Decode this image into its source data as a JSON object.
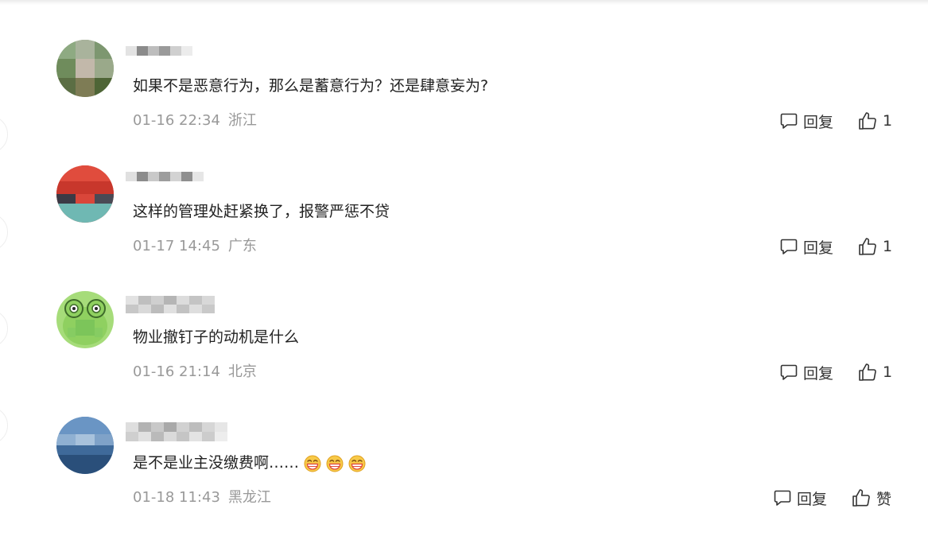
{
  "comments": [
    {
      "text": "如果不是恶意行为，那么是蓄意行为？还是肆意妄为?",
      "time": "01-16 22:34",
      "location": "浙江",
      "reply_label": "回复",
      "like_label": "1"
    },
    {
      "text": "这样的管理处赶紧换了，报警严惩不贷",
      "time": "01-17 14:45",
      "location": "广东",
      "reply_label": "回复",
      "like_label": "1"
    },
    {
      "text": "物业撤钉子的动机是什么",
      "time": "01-16 21:14",
      "location": "北京",
      "reply_label": "回复",
      "like_label": "1"
    },
    {
      "text": "是不是业主没缴费啊……",
      "time": "01-18 11:43",
      "location": "黑龙江",
      "reply_label": "回复",
      "like_label": "赞",
      "emoji_count": 3
    }
  ],
  "icons": {
    "reply": "speech-bubble-icon",
    "like": "thumbs-up-icon",
    "emoji": "grinning-face-emoji"
  },
  "colors": {
    "text": "#222222",
    "meta": "#999999",
    "action": "#333333"
  }
}
